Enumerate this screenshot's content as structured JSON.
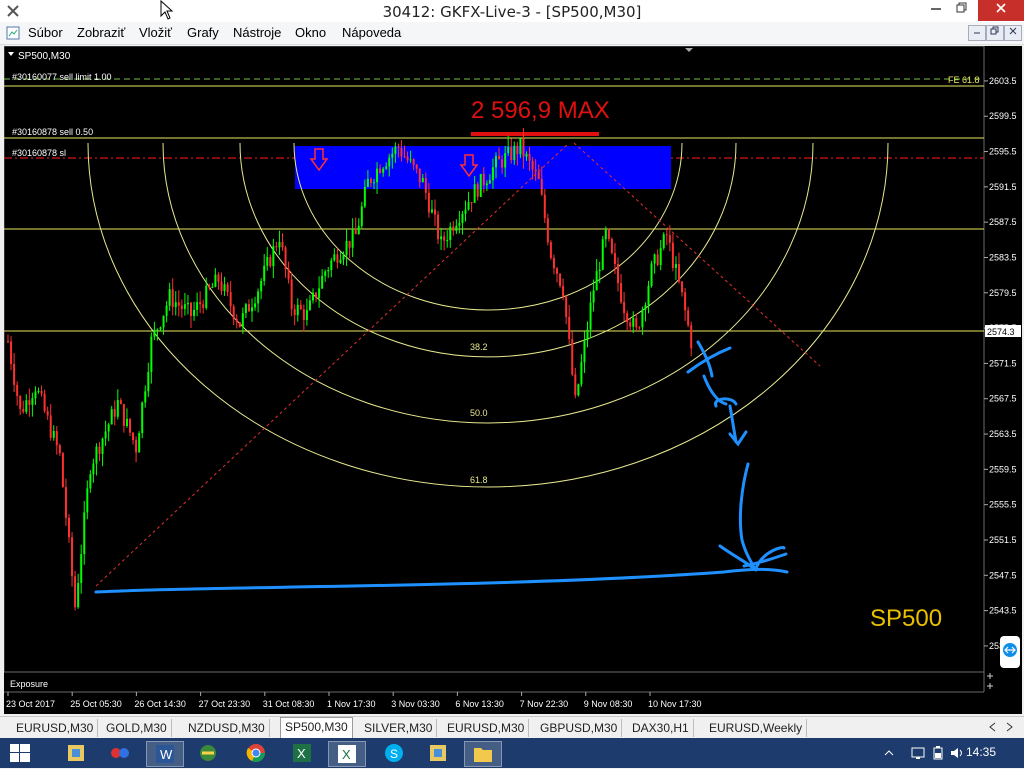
{
  "window": {
    "title": "30412: GKFX-Live-3 - [SP500,M30]",
    "minimize_icon": "minimize-icon",
    "maximize_icon": "restore-icon",
    "close_icon": "close-icon"
  },
  "menu": {
    "items": [
      {
        "label": "Súbor"
      },
      {
        "label": "Zobraziť"
      },
      {
        "label": "Vložiť"
      },
      {
        "label": "Grafy"
      },
      {
        "label": "Nástroje"
      },
      {
        "label": "Okno"
      },
      {
        "label": "Nápoveda"
      }
    ]
  },
  "chart": {
    "header": "SP500,M30",
    "order_labels": [
      "#30160077 sell limit 1.00",
      "#30160878 sell 0.50",
      "#30160878 sl"
    ],
    "fe_label": "FE 61.8",
    "max_label": "2 596,9 MAX",
    "symbol_watermark": "SP500",
    "current_price": "2574.3",
    "fib_labels": [
      "38.2",
      "50.0",
      "61.8"
    ],
    "exposure_label": "Exposure",
    "colors": {
      "bull": "#00ff00",
      "bear": "#ff3030",
      "zone": "#0000ff",
      "annotation": "#1e90ff",
      "max": "#e01010",
      "watermark": "#e8c000"
    }
  },
  "chart_data": {
    "type": "candlestick",
    "y_ticks": [
      "2603.5",
      "2599.5",
      "2595.5",
      "2591.5",
      "2587.5",
      "2583.5",
      "2579.5",
      "2575.5",
      "2571.5",
      "2567.5",
      "2563.5",
      "2559.5",
      "2555.5",
      "2551.5",
      "2547.5",
      "2543.5",
      "2539.5"
    ],
    "x_ticks": [
      "23 Oct 2017",
      "25 Oct 05:30",
      "26 Oct 14:30",
      "27 Oct 23:30",
      "31 Oct 08:30",
      "1 Nov 17:30",
      "3 Nov 03:30",
      "6 Nov 13:30",
      "7 Nov 22:30",
      "9 Nov 08:30",
      "10 Nov 17:30"
    ],
    "ylim": [
      2537,
      2607
    ],
    "series_path": [
      [
        0,
        2574
      ],
      [
        4,
        2566
      ],
      [
        9,
        2569
      ],
      [
        17,
        2561
      ],
      [
        22,
        2544
      ],
      [
        27,
        2560
      ],
      [
        36,
        2567
      ],
      [
        42,
        2562
      ],
      [
        47,
        2574
      ],
      [
        53,
        2579
      ],
      [
        60,
        2577
      ],
      [
        69,
        2581
      ],
      [
        76,
        2576
      ],
      [
        82,
        2580
      ],
      [
        89,
        2586
      ],
      [
        93,
        2578
      ],
      [
        98,
        2577
      ],
      [
        104,
        2582
      ],
      [
        108,
        2584
      ],
      [
        114,
        2586
      ],
      [
        118,
        2592
      ],
      [
        122,
        2594
      ],
      [
        128,
        2596
      ],
      [
        136,
        2592
      ],
      [
        142,
        2585
      ],
      [
        147,
        2588
      ],
      [
        153,
        2591
      ],
      [
        160,
        2594
      ],
      [
        168,
        2596
      ],
      [
        174,
        2592
      ],
      [
        178,
        2584
      ],
      [
        182,
        2580
      ],
      [
        186,
        2567
      ],
      [
        192,
        2580
      ],
      [
        196,
        2586
      ],
      [
        202,
        2578
      ],
      [
        206,
        2575
      ],
      [
        211,
        2582
      ],
      [
        216,
        2586
      ],
      [
        221,
        2579
      ],
      [
        224,
        2574
      ]
    ]
  },
  "tabs": [
    {
      "label": "EURUSD,M30"
    },
    {
      "label": "GOLD,M30"
    },
    {
      "label": "NZDUSD,M30"
    },
    {
      "label": "SP500,M30"
    },
    {
      "label": "SILVER,M30"
    },
    {
      "label": "EURUSD,M30"
    },
    {
      "label": "GBPUSD,M30"
    },
    {
      "label": "DAX30,H1"
    },
    {
      "label": "EURUSD,Weekly"
    }
  ],
  "taskbar": {
    "clock": "14:35"
  }
}
